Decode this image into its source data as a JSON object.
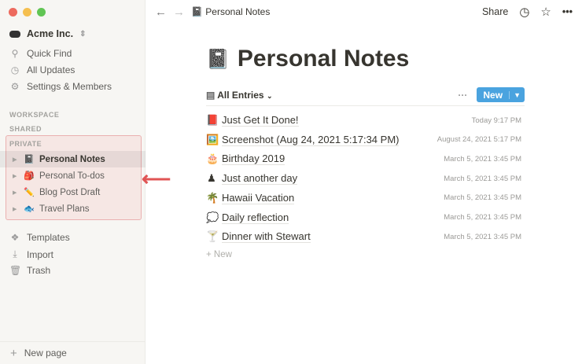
{
  "window": {
    "light_colors": [
      "#ed6a5e",
      "#f5bf4f",
      "#61c554"
    ]
  },
  "sidebar": {
    "workspace": "Acme Inc.",
    "nav": [
      {
        "icon": "search-icon",
        "glyph": "⚲",
        "label": "Quick Find"
      },
      {
        "icon": "clock-icon",
        "glyph": "◷",
        "label": "All Updates"
      },
      {
        "icon": "gear-icon",
        "glyph": "⚙",
        "label": "Settings & Members"
      }
    ],
    "sections": {
      "workspace": "WORKSPACE",
      "shared": "SHARED",
      "private": "PRIVATE"
    },
    "pages": [
      {
        "emoji": "📓",
        "label": "Personal Notes",
        "active": true
      },
      {
        "emoji": "🎒",
        "label": "Personal To-dos"
      },
      {
        "emoji": "✏️",
        "label": "Blog Post Draft"
      },
      {
        "emoji": "🐟",
        "label": "Travel Plans"
      }
    ],
    "footer_nav": [
      {
        "icon": "templates-icon",
        "glyph": "❖",
        "label": "Templates"
      },
      {
        "icon": "import-icon",
        "glyph": "⤓",
        "label": "Import"
      },
      {
        "icon": "trash-icon",
        "glyph": "🗑",
        "label": "Trash"
      }
    ],
    "new_page": "New page",
    "annotation_color": "#e05555"
  },
  "topbar": {
    "breadcrumb_emoji": "📓",
    "breadcrumb": "Personal Notes",
    "share": "Share"
  },
  "main": {
    "title_emoji": "📓",
    "title": "Personal Notes",
    "view": "All Entries",
    "new_button": "New",
    "accent": "#4aa3df",
    "entries": [
      {
        "emoji": "📕",
        "name": "Just Get It Done!",
        "date": "Today 9:17 PM"
      },
      {
        "emoji": "🖼️",
        "name": "Screenshot (Aug 24, 2021 5:17:34 PM)",
        "date": "August 24, 2021 5:17 PM"
      },
      {
        "emoji": "🎂",
        "name": "Birthday 2019",
        "date": "March 5, 2021 3:45 PM"
      },
      {
        "emoji": "♟",
        "name": "Just another day",
        "date": "March 5, 2021 3:45 PM"
      },
      {
        "emoji": "🌴",
        "name": "Hawaii Vacation",
        "date": "March 5, 2021 3:45 PM"
      },
      {
        "emoji": "💭",
        "name": "Daily reflection",
        "date": "March 5, 2021 3:45 PM"
      },
      {
        "emoji": "🍸",
        "name": "Dinner with Stewart",
        "date": "March 5, 2021 3:45 PM"
      }
    ],
    "add_new": "New"
  }
}
